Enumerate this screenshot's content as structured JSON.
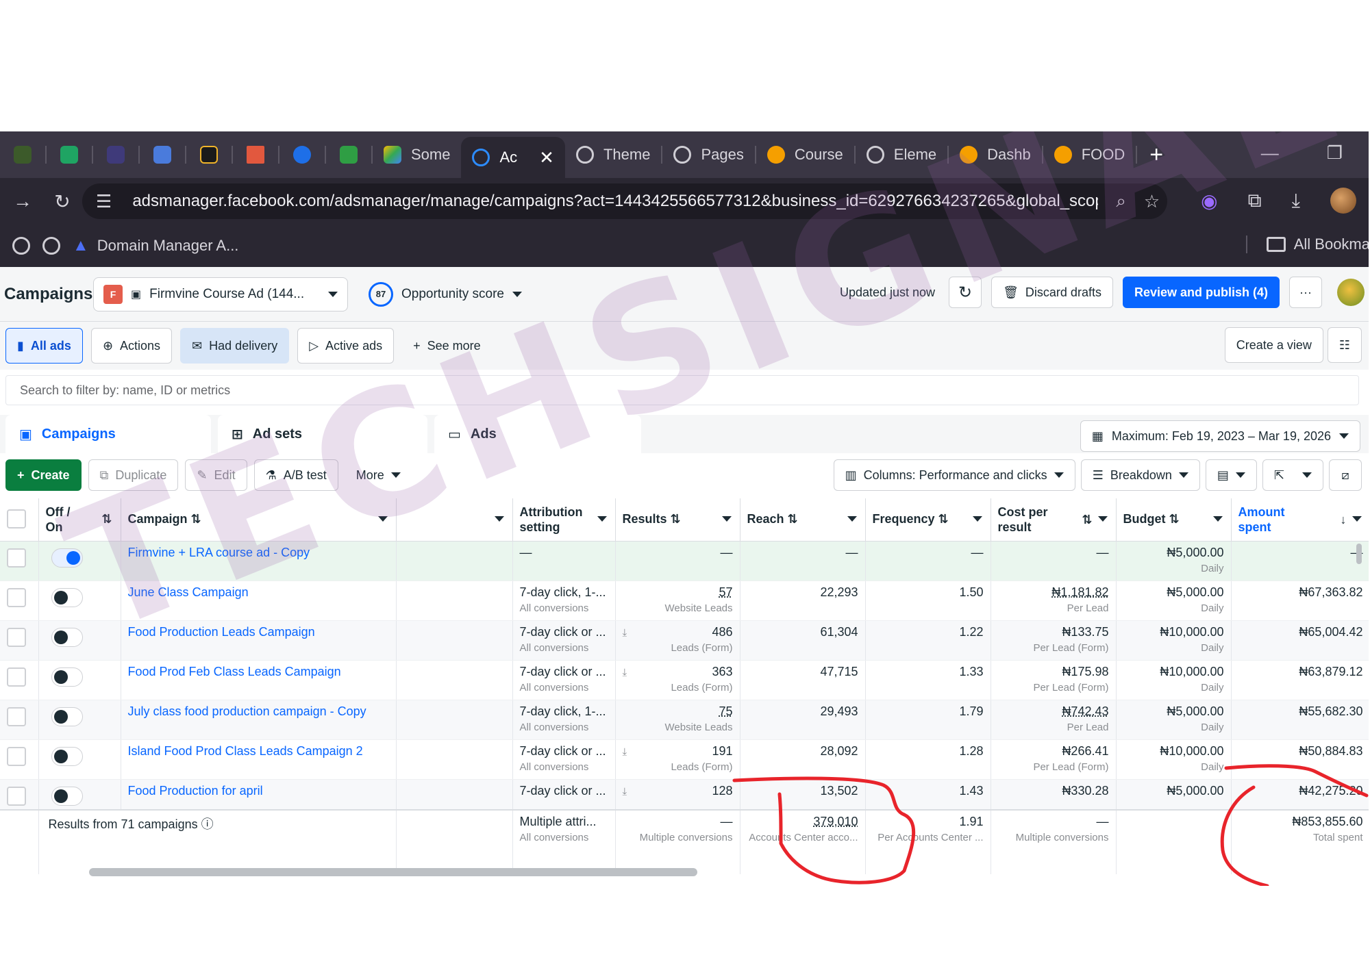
{
  "browser": {
    "tabs": [
      {
        "label": "Some",
        "icon": "drive-icon"
      },
      {
        "label": "Ac",
        "icon": "meta-icon",
        "active": true
      },
      {
        "label": "Theme",
        "icon": "globe-icon"
      },
      {
        "label": "Pages",
        "icon": "globe-icon"
      },
      {
        "label": "Course",
        "icon": "site-icon"
      },
      {
        "label": "Eleme",
        "icon": "globe-icon"
      },
      {
        "label": "Dashb",
        "icon": "site-icon"
      },
      {
        "label": "FOOD",
        "icon": "site-icon"
      }
    ],
    "url": "adsmanager.facebook.com/adsmanager/manage/campaigns?act=1443425566577312&business_id=629276634237265&global_scope...",
    "bookmarks": [
      "Domain Manager A..."
    ],
    "all_bookmarks": "All Bookma"
  },
  "header": {
    "title": "Campaigns",
    "account_badge": "F",
    "account": "Firmvine Course Ad (144...",
    "score": "87",
    "opportunity": "Opportunity score",
    "updated": "Updated just now",
    "discard": "Discard drafts",
    "publish": "Review and publish (4)",
    "more": "···"
  },
  "filters": {
    "all_ads": "All ads",
    "actions": "Actions",
    "had_delivery": "Had delivery",
    "active_ads": "Active ads",
    "see_more": "See more",
    "create_view": "Create a view"
  },
  "search": {
    "placeholder": "Search to filter by: name, ID or metrics"
  },
  "level_tabs": {
    "campaigns": "Campaigns",
    "ad_sets": "Ad sets",
    "ads": "Ads"
  },
  "date_range": "Maximum: Feb 19, 2023 – Mar 19, 2026",
  "toolbar": {
    "create": "Create",
    "duplicate": "Duplicate",
    "edit": "Edit",
    "ab_test": "A/B test",
    "more": "More",
    "columns": "Columns: Performance and clicks",
    "breakdown": "Breakdown"
  },
  "columns": {
    "off_on": "Off / On",
    "campaign": "Campaign",
    "attribution_1": "Attribution",
    "attribution_2": "setting",
    "results": "Results",
    "reach": "Reach",
    "frequency": "Frequency",
    "cost_1": "Cost per",
    "cost_2": "result",
    "budget": "Budget",
    "amount_1": "Amount",
    "amount_2": "spent"
  },
  "rows": [
    {
      "on": true,
      "name": "Firmvine + LRA course ad - Copy",
      "attr": "—",
      "attr_sub": "",
      "results": "—",
      "results_sub": "",
      "reach": "—",
      "freq": "—",
      "cost": "—",
      "cost_sub": "",
      "budget": "₦5,000.00",
      "budget_sub": "Daily",
      "spent": "—"
    },
    {
      "on": false,
      "name": "June Class Campaign",
      "attr": "7-day click, 1-...",
      "attr_sub": "All conversions",
      "results": "57",
      "results_sub": "Website Leads",
      "reach": "22,293",
      "freq": "1.50",
      "cost": "₦1,181.82",
      "cost_sub": "Per Lead",
      "budget": "₦5,000.00",
      "budget_sub": "Daily",
      "spent": "₦67,363.82"
    },
    {
      "on": false,
      "name": "Food Production Leads Campaign",
      "attr": "7-day click or ...",
      "attr_sub": "All conversions",
      "results": "486",
      "results_sub": "Leads (Form)",
      "reach": "61,304",
      "freq": "1.22",
      "cost": "₦133.75",
      "cost_sub": "Per Lead (Form)",
      "budget": "₦10,000.00",
      "budget_sub": "Daily",
      "spent": "₦65,004.42"
    },
    {
      "on": false,
      "name": "Food Prod Feb Class Leads Campaign",
      "attr": "7-day click or ...",
      "attr_sub": "All conversions",
      "results": "363",
      "results_sub": "Leads (Form)",
      "reach": "47,715",
      "freq": "1.33",
      "cost": "₦175.98",
      "cost_sub": "Per Lead (Form)",
      "budget": "₦10,000.00",
      "budget_sub": "Daily",
      "spent": "₦63,879.12"
    },
    {
      "on": false,
      "name": "July class food production campaign - Copy",
      "attr": "7-day click, 1-...",
      "attr_sub": "All conversions",
      "results": "75",
      "results_sub": "Website Leads",
      "reach": "29,493",
      "freq": "1.79",
      "cost": "₦742.43",
      "cost_sub": "Per Lead",
      "budget": "₦5,000.00",
      "budget_sub": "Daily",
      "spent": "₦55,682.30"
    },
    {
      "on": false,
      "name": "Island Food Prod Class Leads Campaign 2",
      "attr": "7-day click or ...",
      "attr_sub": "All conversions",
      "results": "191",
      "results_sub": "Leads (Form)",
      "reach": "28,092",
      "freq": "1.28",
      "cost": "₦266.41",
      "cost_sub": "Per Lead (Form)",
      "budget": "₦10,000.00",
      "budget_sub": "Daily",
      "spent": "₦50,884.83"
    },
    {
      "on": false,
      "name": "Food Production for april",
      "attr": "7-day click or ...",
      "attr_sub": "",
      "results": "128",
      "results_sub": "",
      "reach": "13,502",
      "freq": "1.43",
      "cost": "₦330.28",
      "cost_sub": "",
      "budget": "₦5,000.00",
      "budget_sub": "",
      "spent": "₦42,275.20"
    }
  ],
  "totals": {
    "label": "Results from 71 campaigns",
    "attr": "Multiple attri...",
    "attr_sub": "All conversions",
    "results": "—",
    "results_sub": "Multiple conversions",
    "reach": "379,010",
    "reach_sub": "Accounts Center acco...",
    "freq": "1.91",
    "freq_sub": "Per Accounts Center ...",
    "cost": "—",
    "cost_sub": "Multiple conversions",
    "spent": "₦853,855.60",
    "spent_sub": "Total spent"
  },
  "watermark": "TECHSIGNALS",
  "colors": {
    "accent": "#0866ff",
    "create": "#0a7e3f",
    "annotation": "#e8242b",
    "watermark": "#965fa5"
  }
}
